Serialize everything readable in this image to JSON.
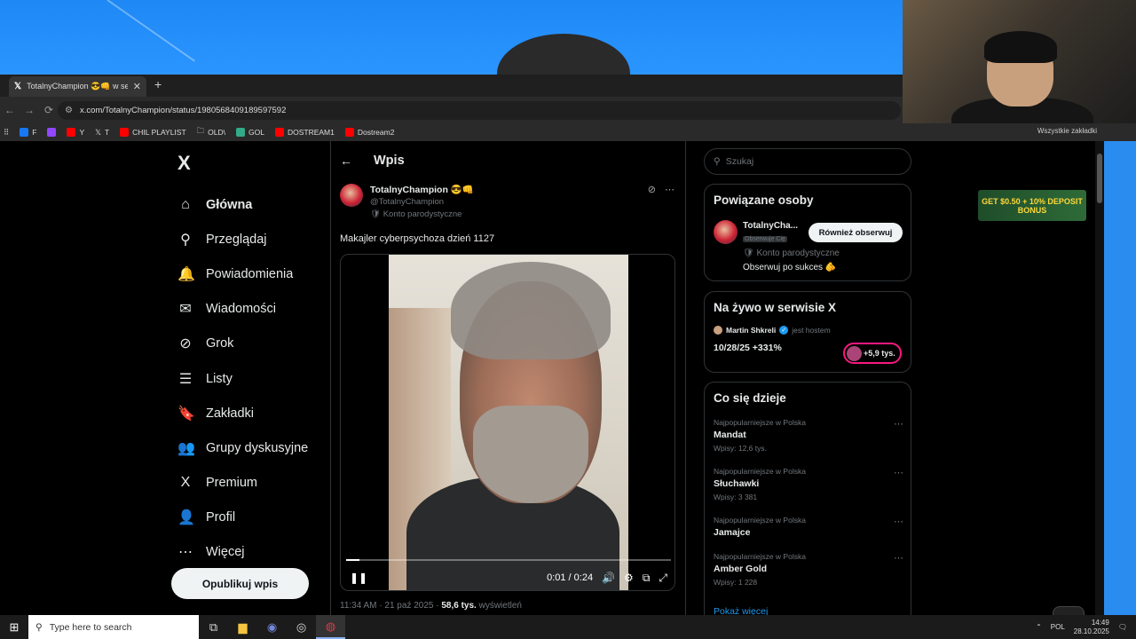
{
  "browser": {
    "tab_title": "TotalnyChampion 😎👊 w serwi",
    "new_tab_symbol": "+",
    "url": "x.com/TotalnyChampion/status/1980568409189597592",
    "bookmarks": [
      "F",
      "Y",
      "T",
      "CHIL PLAYLIST",
      "OLD\\",
      "GOL",
      "DOSTREAM1",
      "Dostream2"
    ],
    "bookmarks_right": "Wszystkie zakładki"
  },
  "sidebar": {
    "logo": "X",
    "items": [
      {
        "label": "Główna",
        "icon": "⌂"
      },
      {
        "label": "Przeglądaj",
        "icon": "⚲"
      },
      {
        "label": "Powiadomienia",
        "icon": "🔔"
      },
      {
        "label": "Wiadomości",
        "icon": "✉"
      },
      {
        "label": "Grok",
        "icon": "⊘"
      },
      {
        "label": "Listy",
        "icon": "☰"
      },
      {
        "label": "Zakładki",
        "icon": "🔖"
      },
      {
        "label": "Grupy dyskusyjne",
        "icon": "👥"
      },
      {
        "label": "Premium",
        "icon": "X"
      },
      {
        "label": "Profil",
        "icon": "👤"
      },
      {
        "label": "Więcej",
        "icon": "⋯"
      }
    ],
    "publish_label": "Opublikuj wpis"
  },
  "main": {
    "back": "←",
    "header": "Wpis",
    "author_name": "TotalnyChampion 😎👊",
    "author_handle": "@TotalnyChampion",
    "author_label": "🛡 Konto parodystyczne",
    "post_text": "Makajler cyberpsychoza dzień 1127",
    "video_time": "0:01 / 0:24",
    "video_progress": 0.042,
    "meta_time": "11:34 AM · 21 paź 2025 · ",
    "meta_views": "58,6 tys.",
    "meta_views_label": " wyświetleń"
  },
  "right": {
    "search_placeholder": "Szukaj",
    "related": {
      "title": "Powiązane osoby",
      "name": "TotalnyCha...",
      "follows_you": "Obserwuje Cię",
      "follow_label": "Również obserwuj",
      "parody": "🛡 Konto parodystyczne",
      "bio": "Obserwuj po sukces 🫵"
    },
    "live": {
      "title": "Na żywo w serwisie X",
      "host": "Martin Shkreli",
      "host_suffix": "jest hostem",
      "space_title": "10/28/25 +331%",
      "listeners": "+5,9 tys."
    },
    "trends": {
      "title": "Co się dzieje",
      "items": [
        {
          "category": "Najpopularniejsze w Polska",
          "topic": "Mandat",
          "count": "Wpisy: 12,6 tys."
        },
        {
          "category": "Najpopularniejsze w Polska",
          "topic": "Słuchawki",
          "count": "Wpisy: 3 381"
        },
        {
          "category": "Najpopularniejsze w Polska",
          "topic": "Jamajce",
          "count": ""
        },
        {
          "category": "Najpopularniejsze w Polska",
          "topic": "Amber Gold",
          "count": "Wpisy: 1 228"
        }
      ],
      "show_more": "Pokaż więcej"
    }
  },
  "ad": {
    "text": "GET $0.50 + 10% DEPOSIT BONUS"
  },
  "taskbar": {
    "search_placeholder": "Type here to search",
    "language": "POL",
    "time": "14:49",
    "date": "28.10.2025"
  }
}
